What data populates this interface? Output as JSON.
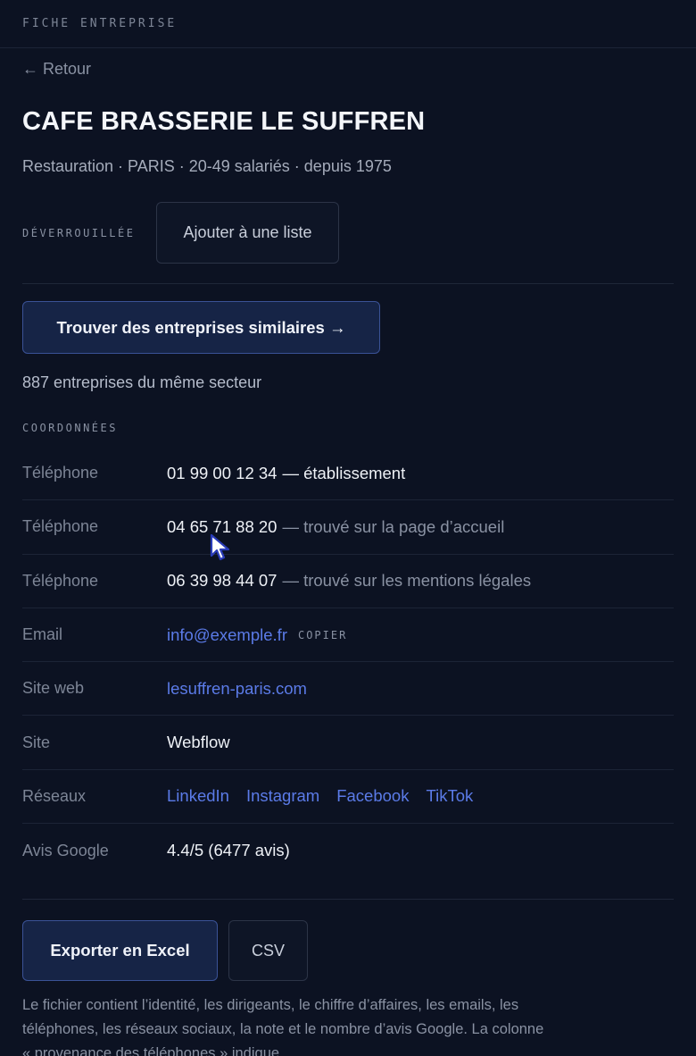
{
  "header": {
    "title": "FICHE ENTREPRISE"
  },
  "nav": {
    "back_label": "← Retour"
  },
  "company": {
    "name": "CAFE BRASSERIE LE SUFFREN",
    "meta": "Restauration · PARIS · 20-49 salariés · depuis 1975",
    "status": "DÉVERROUILLÉE",
    "add_to_list_label": "Ajouter à une liste"
  },
  "similar": {
    "button_label": "Trouver des entreprises similaires →",
    "count_text": "887 entreprises du même secteur"
  },
  "contacts": {
    "section_title": "COORDONNÉES",
    "phones": [
      {
        "label": "Téléphone",
        "number": "01 99 00 12 34",
        "note": "— établissement"
      },
      {
        "label": "Téléphone",
        "number": "04 65 71 88 20",
        "note": "— trouvé sur la page d’accueil"
      },
      {
        "label": "Téléphone",
        "number": "06 39 98 44 07",
        "note": "— trouvé sur les mentions légales"
      }
    ],
    "email": {
      "label": "Email",
      "value": "info@exemple.fr",
      "copy_label": "COPIER"
    },
    "website": {
      "label": "Site web",
      "value": "lesuffren-paris.com"
    },
    "platform": {
      "label": "Site",
      "value": "Webflow"
    },
    "social": {
      "label": "Réseaux",
      "links": [
        "LinkedIn",
        "Instagram",
        "Facebook",
        "TikTok"
      ]
    },
    "google": {
      "label": "Avis Google",
      "value": "4.4/5 (6477 avis)"
    }
  },
  "export": {
    "excel_label": "Exporter en Excel",
    "csv_label": "CSV",
    "note": "Le fichier contient l’identité, les dirigeants, le chiffre d’affaires, les emails, les téléphones, les réseaux sociaux, la note et le nombre d’avis Google. La colonne « provenance des téléphones » indique"
  },
  "colors": {
    "background": "#0c1222",
    "link": "#5b7be8",
    "primary_button_bg": "#162446",
    "primary_button_border": "#3a5296"
  },
  "icons": {
    "cursor": "mouse-pointer-icon"
  }
}
